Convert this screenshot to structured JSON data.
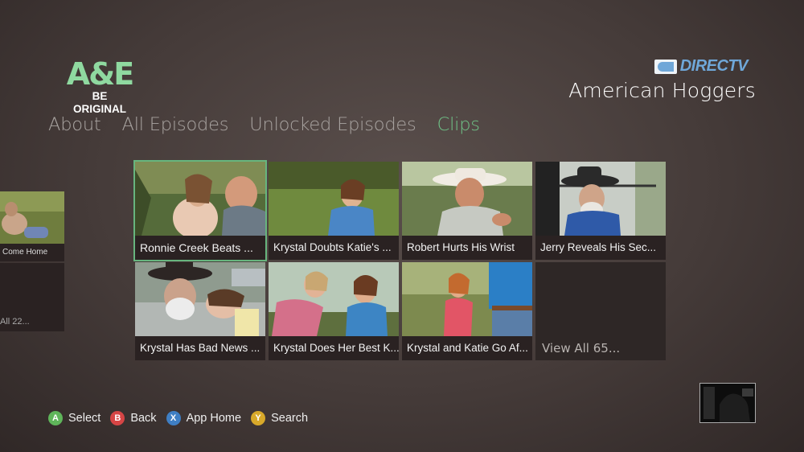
{
  "app": {
    "logo_main": "A&E",
    "logo_tagline": "BE ORIGINAL",
    "provider": "DIRECTV",
    "show_title": "American Hoggers"
  },
  "tabs": [
    {
      "label": "About",
      "active": false
    },
    {
      "label": "All Episodes",
      "active": false
    },
    {
      "label": "Unlocked Episodes",
      "active": false
    },
    {
      "label": "Clips",
      "active": true
    }
  ],
  "previous_panel": {
    "caption": "Come Home",
    "more_label": "All 22..."
  },
  "clips": [
    {
      "title": "Ronnie Creek Beats ...",
      "selected": true
    },
    {
      "title": "Krystal Doubts Katie's ...",
      "selected": false
    },
    {
      "title": "Robert Hurts His Wrist",
      "selected": false
    },
    {
      "title": "Jerry Reveals His Sec...",
      "selected": false
    },
    {
      "title": "Krystal Has Bad News ...",
      "selected": false
    },
    {
      "title": "Krystal Does Her Best K...",
      "selected": false
    },
    {
      "title": "Krystal and Katie Go Af...",
      "selected": false
    }
  ],
  "view_all_label": "View All 65...",
  "controller_hints": [
    {
      "button": "A",
      "label": "Select",
      "color": "#5fb55a"
    },
    {
      "button": "B",
      "label": "Back",
      "color": "#d64545"
    },
    {
      "button": "X",
      "label": "App Home",
      "color": "#3f7fc4"
    },
    {
      "button": "Y",
      "label": "Search",
      "color": "#d8a92a"
    }
  ],
  "colors": {
    "accent": "#6fc287",
    "tab_inactive": "#a9a4a1",
    "directv_blue": "#6fa7d8"
  }
}
